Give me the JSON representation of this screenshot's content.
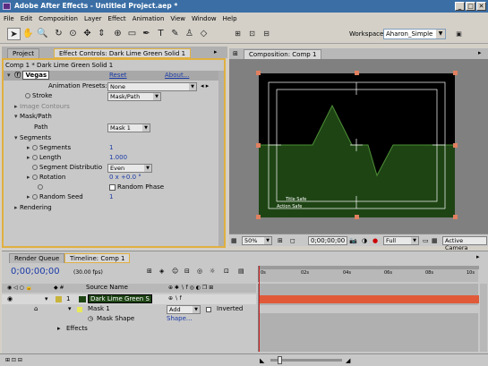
{
  "window": {
    "title": "Adobe After Effects - Untitled Project.aep *",
    "min": "_",
    "max": "□",
    "close": "✕"
  },
  "menu": [
    "File",
    "Edit",
    "Composition",
    "Layer",
    "Effect",
    "Animation",
    "View",
    "Window",
    "Help"
  ],
  "toolbar": {
    "workspace_label": "Workspace:",
    "workspace_value": "Aharon_Simple"
  },
  "effect_panel": {
    "tabs": [
      "Project",
      "Effect Controls: Dark Lime Green Solid 1"
    ],
    "breadcrumb": "Comp 1 * Dark Lime Green Solid 1",
    "effect_name": "Vegas",
    "reset": "Reset",
    "about": "About...",
    "rows": {
      "presets_label": "Animation Presets:",
      "presets_value": "None",
      "stroke_label": "Stroke",
      "stroke_value": "Mask/Path",
      "image_contours": "Image Contours",
      "mask_path": "Mask/Path",
      "path_label": "Path",
      "path_value": "Mask 1",
      "segments_group": "Segments",
      "segments_label": "Segments",
      "segments_value": "1",
      "length_label": "Length",
      "length_value": "1.000",
      "distrib_label": "Segment Distributio",
      "distrib_value": "Even",
      "rotation_label": "Rotation",
      "rotation_value": "0 x +0.0 °",
      "random_phase": "Random Phase",
      "seed_label": "Random Seed",
      "seed_value": "1",
      "rendering": "Rendering"
    }
  },
  "comp_panel": {
    "tab": "Composition: Comp 1",
    "title_safe": "Title Safe",
    "action_safe": "Action Safe",
    "zoom": "50%",
    "timecode": "0;00;00;00",
    "resolution": "Full",
    "camera": "Active Camera"
  },
  "timeline": {
    "tabs": [
      "Render Queue",
      "Timeline: Comp 1"
    ],
    "timecode": "0;00;00;00",
    "fps": "(30.00 fps)",
    "col_source": "Source Name",
    "ruler": [
      "0s",
      "02s",
      "04s",
      "06s",
      "08s",
      "10s"
    ],
    "layer_num": "1",
    "layer_name": "Dark Lime Green S",
    "mask_name": "Mask 1",
    "mask_mode": "Add",
    "inverted": "Inverted",
    "mask_shape": "Mask Shape",
    "mask_shape_val": "Shape...",
    "effects": "Effects"
  },
  "colors": {
    "solid": "#1e4414",
    "layer_bar": "#e05a3a",
    "title_bar": "#3a6ea5",
    "effect_border": "#e0b040"
  }
}
